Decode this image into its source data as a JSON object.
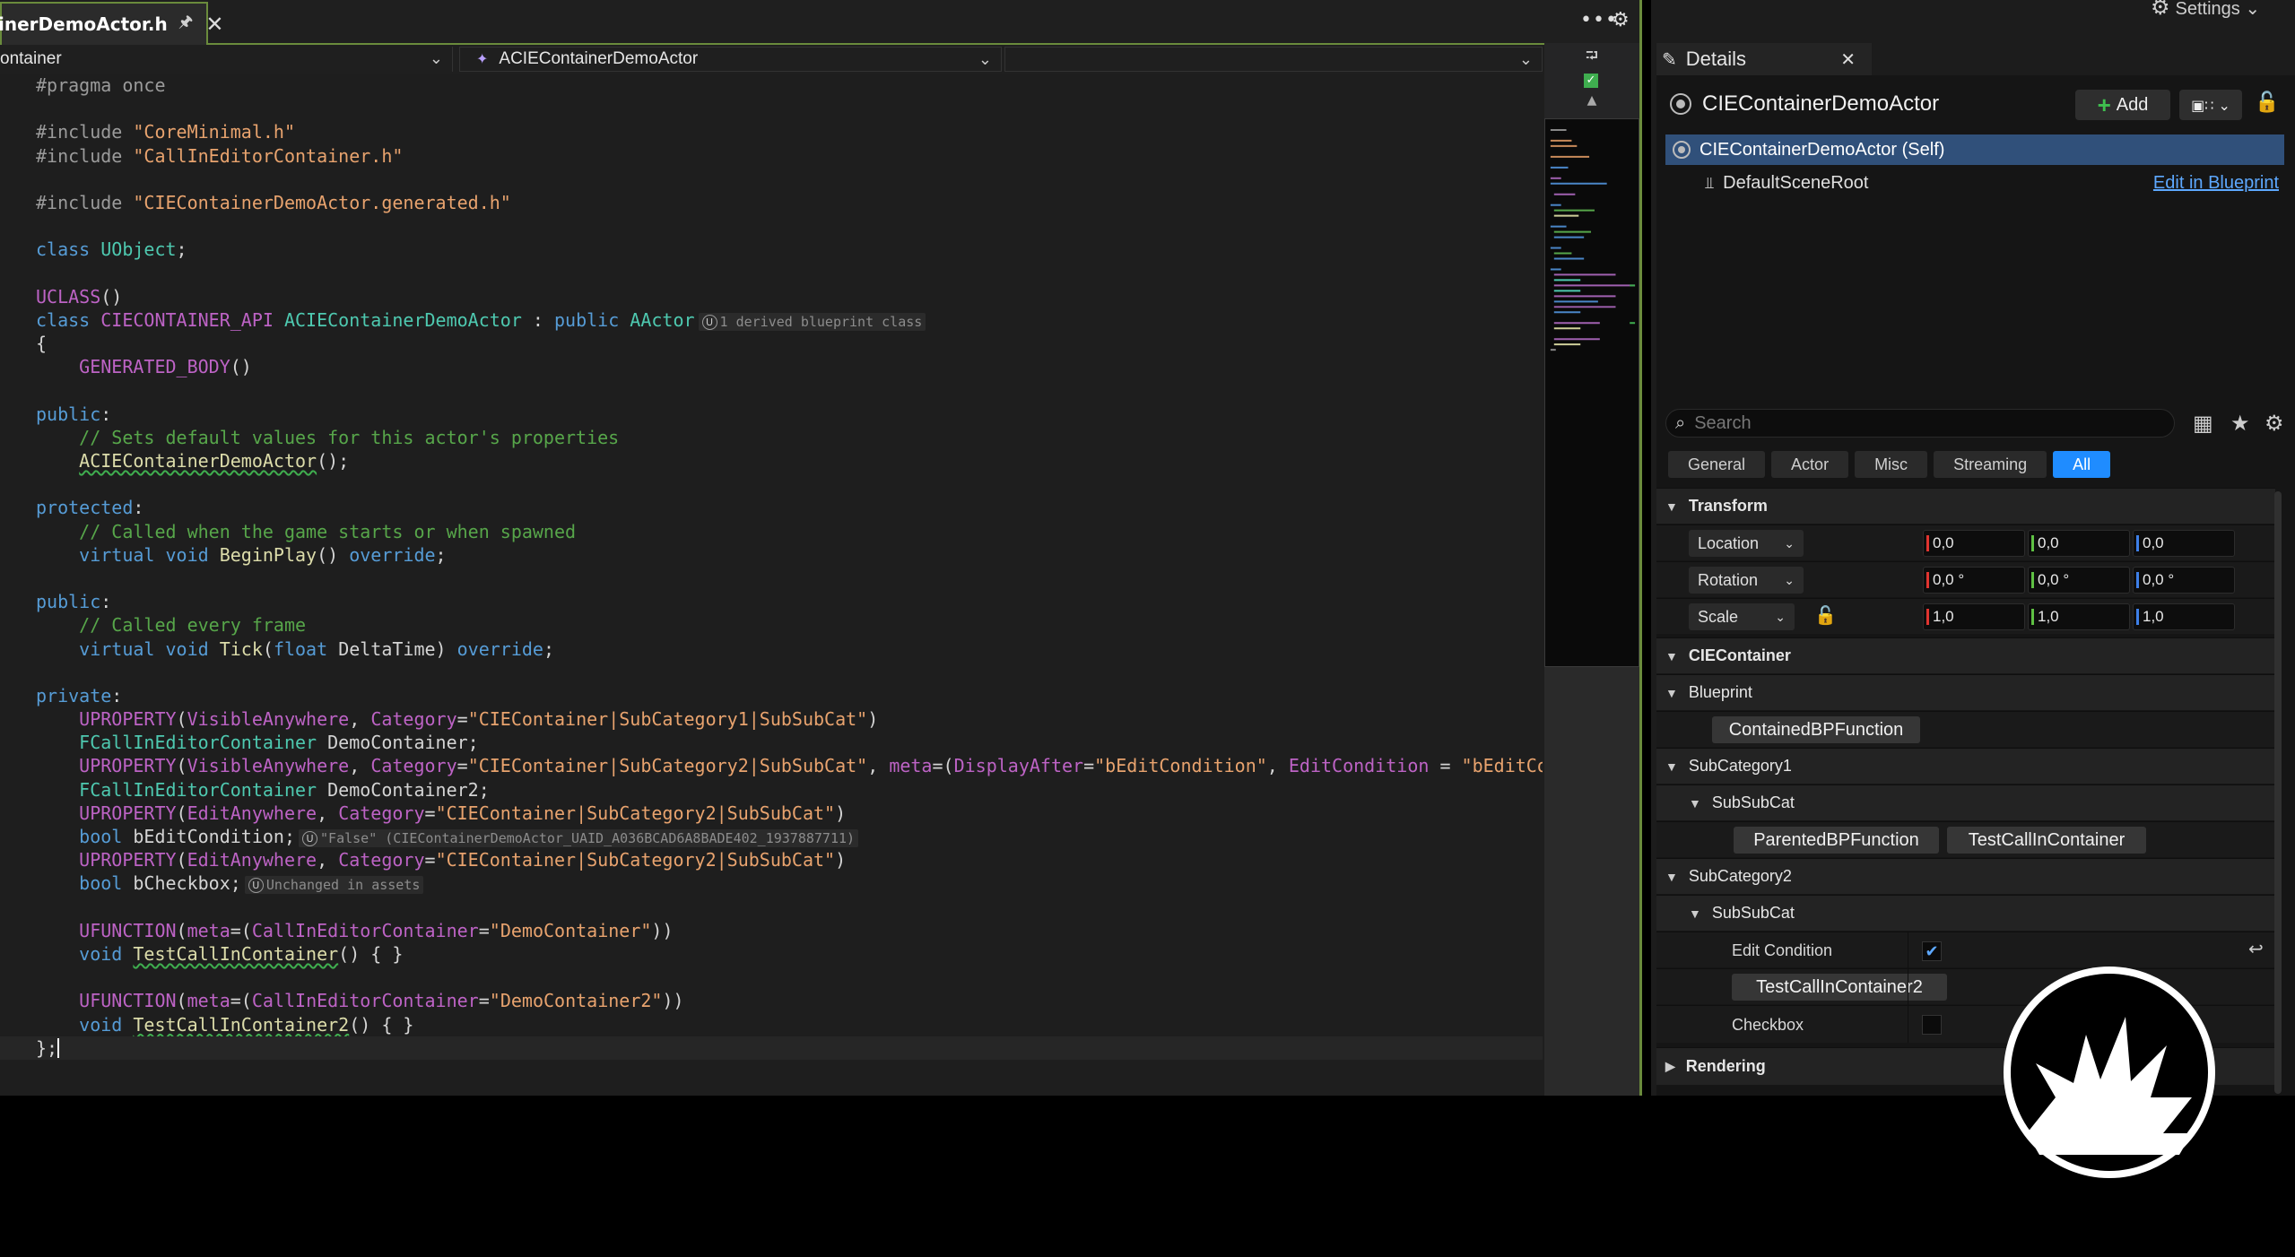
{
  "editor": {
    "tab": {
      "filename": "inerDemoActor.h",
      "pin_icon": "pin-icon",
      "close_icon": "close-icon"
    },
    "tab_actions": {
      "overflow": "•••",
      "settings_icon": "gear-icon"
    },
    "nav": {
      "scope": "ontainer",
      "class_selector": "ACIEContainerDemoActor",
      "member_selector": ""
    },
    "colors": {
      "accent_border": "#6a8b3c",
      "background": "#1e1e1e"
    }
  },
  "details": {
    "settings_label": "Settings",
    "tab_label": "Details",
    "actor_name": "CIEContainerDemoActor",
    "add_label": "Add",
    "tree": {
      "self_label": "CIEContainerDemoActor (Self)",
      "child_label": "DefaultSceneRoot",
      "edit_link": "Edit in Blueprint"
    },
    "search_placeholder": "Search",
    "filters": [
      "General",
      "Actor",
      "Misc",
      "Streaming",
      "All"
    ],
    "active_filter": "All",
    "transform": {
      "label": "Transform",
      "location": {
        "label": "Location",
        "x": "0,0",
        "y": "0,0",
        "z": "0,0"
      },
      "rotation": {
        "label": "Rotation",
        "x": "0,0 °",
        "y": "0,0 °",
        "z": "0,0 °"
      },
      "scale": {
        "label": "Scale",
        "x": "1,0",
        "y": "1,0",
        "z": "1,0"
      }
    },
    "categories": {
      "cie": "CIEContainer",
      "blueprint": "Blueprint",
      "sub1": "SubCategory1",
      "subsub1": "SubSubCat",
      "sub2": "SubCategory2",
      "subsub2": "SubSubCat",
      "rendering": "Rendering"
    },
    "buttons": {
      "contained": "ContainedBPFunction",
      "parented": "ParentedBPFunction",
      "test1": "TestCallInContainer",
      "test2": "TestCallInContainer2"
    },
    "props": {
      "edit_condition": "Edit Condition",
      "edit_condition_checked": true,
      "checkbox": "Checkbox",
      "checkbox_checked": false
    },
    "colors": {
      "selection": "#30507a",
      "active_filter": "#1f8cff",
      "link": "#5da8ff"
    }
  },
  "code_lines": [
    [
      [
        "#pragma once",
        "pp"
      ]
    ],
    [],
    [
      [
        "#include ",
        "pp"
      ],
      [
        "\"CoreMinimal.h\"",
        "str"
      ]
    ],
    [
      [
        "#include ",
        "pp"
      ],
      [
        "\"CallInEditorContainer.h\"",
        "str"
      ]
    ],
    [],
    [
      [
        "#include ",
        "pp"
      ],
      [
        "\"CIEContainerDemoActor.generated.h\"",
        "str"
      ]
    ],
    [],
    [
      [
        "class ",
        "kw"
      ],
      [
        "UObject",
        "type"
      ],
      [
        ";",
        "plain"
      ]
    ],
    [],
    [
      [
        "UCLASS",
        "macro"
      ],
      [
        "()",
        "plain"
      ]
    ],
    [
      [
        "class ",
        "kw"
      ],
      [
        "CIECONTAINER_API ",
        "macro"
      ],
      [
        "ACIEContainerDemoActor",
        "type"
      ],
      [
        " : ",
        "plain"
      ],
      [
        "public ",
        "kw"
      ],
      [
        "AActor",
        "type"
      ],
      [
        "1 derived blueprint class",
        "hint"
      ]
    ],
    [
      [
        "{",
        "plain"
      ]
    ],
    [
      [
        "    ",
        "plain"
      ],
      [
        "GENERATED_BODY",
        "macro"
      ],
      [
        "()",
        "plain"
      ]
    ],
    [],
    [
      [
        "public",
        "kw"
      ],
      [
        ":",
        "plain"
      ]
    ],
    [
      [
        "    ",
        "plain"
      ],
      [
        "// Sets default values for this actor's properties",
        "cmt"
      ]
    ],
    [
      [
        "    ",
        "plain"
      ],
      [
        "ACIEContainerDemoActor",
        "fnu"
      ],
      [
        "();",
        "plain"
      ]
    ],
    [],
    [
      [
        "protected",
        "kw"
      ],
      [
        ":",
        "plain"
      ]
    ],
    [
      [
        "    ",
        "plain"
      ],
      [
        "// Called when the game starts or when spawned",
        "cmt"
      ]
    ],
    [
      [
        "    ",
        "plain"
      ],
      [
        "virtual ",
        "kw"
      ],
      [
        "void ",
        "kw"
      ],
      [
        "BeginPlay",
        "fn"
      ],
      [
        "() ",
        "plain"
      ],
      [
        "override",
        "kw"
      ],
      [
        ";",
        "plain"
      ]
    ],
    [],
    [
      [
        "public",
        "kw"
      ],
      [
        ":",
        "plain"
      ]
    ],
    [
      [
        "    ",
        "plain"
      ],
      [
        "// Called every frame",
        "cmt"
      ]
    ],
    [
      [
        "    ",
        "plain"
      ],
      [
        "virtual ",
        "kw"
      ],
      [
        "void ",
        "kw"
      ],
      [
        "Tick",
        "fn"
      ],
      [
        "(",
        "plain"
      ],
      [
        "float ",
        "kw"
      ],
      [
        "DeltaTime) ",
        "plain"
      ],
      [
        "override",
        "kw"
      ],
      [
        ";",
        "plain"
      ]
    ],
    [],
    [
      [
        "private",
        "kw"
      ],
      [
        ":",
        "plain"
      ]
    ],
    [
      [
        "    ",
        "plain"
      ],
      [
        "UPROPERTY",
        "macro"
      ],
      [
        "(",
        "plain"
      ],
      [
        "VisibleAnywhere",
        "macro"
      ],
      [
        ", ",
        "plain"
      ],
      [
        "Category",
        "macro"
      ],
      [
        "=",
        "plain"
      ],
      [
        "\"CIEContainer|SubCategory1|SubSubCat\"",
        "str"
      ],
      [
        ")",
        "plain"
      ]
    ],
    [
      [
        "    ",
        "plain"
      ],
      [
        "FCallInEditorContainer ",
        "type"
      ],
      [
        "DemoContainer;",
        "plain"
      ]
    ],
    [
      [
        "    ",
        "plain"
      ],
      [
        "UPROPERTY",
        "macro"
      ],
      [
        "(",
        "plain"
      ],
      [
        "VisibleAnywhere",
        "macro"
      ],
      [
        ", ",
        "plain"
      ],
      [
        "Category",
        "macro"
      ],
      [
        "=",
        "plain"
      ],
      [
        "\"CIEContainer|SubCategory2|SubSubCat\"",
        "str"
      ],
      [
        ", ",
        "plain"
      ],
      [
        "meta",
        "macro"
      ],
      [
        "=(",
        "plain"
      ],
      [
        "DisplayAfter",
        "macro"
      ],
      [
        "=",
        "plain"
      ],
      [
        "\"bEditCondition\"",
        "str"
      ],
      [
        ", ",
        "plain"
      ],
      [
        "EditCondition",
        "macro"
      ],
      [
        " = ",
        "plain"
      ],
      [
        "\"bEditCondi",
        "str"
      ]
    ],
    [
      [
        "    ",
        "plain"
      ],
      [
        "FCallInEditorContainer ",
        "type"
      ],
      [
        "DemoContainer2;",
        "plain"
      ]
    ],
    [
      [
        "    ",
        "plain"
      ],
      [
        "UPROPERTY",
        "macro"
      ],
      [
        "(",
        "plain"
      ],
      [
        "EditAnywhere",
        "macro"
      ],
      [
        ", ",
        "plain"
      ],
      [
        "Category",
        "macro"
      ],
      [
        "=",
        "plain"
      ],
      [
        "\"CIEContainer|SubCategory2|SubSubCat\"",
        "str"
      ],
      [
        ")",
        "plain"
      ]
    ],
    [
      [
        "    ",
        "plain"
      ],
      [
        "bool ",
        "kw"
      ],
      [
        "bEditCondition;",
        "plain"
      ],
      [
        "\"False\" (CIEContainerDemoActor_UAID_A036BCAD6A8BADE402_1937887711)",
        "hint"
      ]
    ],
    [
      [
        "    ",
        "plain"
      ],
      [
        "UPROPERTY",
        "macro"
      ],
      [
        "(",
        "plain"
      ],
      [
        "EditAnywhere",
        "macro"
      ],
      [
        ", ",
        "plain"
      ],
      [
        "Category",
        "macro"
      ],
      [
        "=",
        "plain"
      ],
      [
        "\"CIEContainer|SubCategory2|SubSubCat\"",
        "str"
      ],
      [
        ")",
        "plain"
      ]
    ],
    [
      [
        "    ",
        "plain"
      ],
      [
        "bool ",
        "kw"
      ],
      [
        "bCheckbox;",
        "plain"
      ],
      [
        "Unchanged in assets",
        "hint"
      ]
    ],
    [],
    [
      [
        "    ",
        "plain"
      ],
      [
        "UFUNCTION",
        "macro"
      ],
      [
        "(",
        "plain"
      ],
      [
        "meta",
        "macro"
      ],
      [
        "=(",
        "plain"
      ],
      [
        "CallInEditorContainer",
        "macro"
      ],
      [
        "=",
        "plain"
      ],
      [
        "\"DemoContainer\"",
        "str"
      ],
      [
        "))",
        "plain"
      ]
    ],
    [
      [
        "    ",
        "plain"
      ],
      [
        "void ",
        "kw"
      ],
      [
        "TestCallInContainer",
        "fnu"
      ],
      [
        "() { }",
        "plain"
      ]
    ],
    [],
    [
      [
        "    ",
        "plain"
      ],
      [
        "UFUNCTION",
        "macro"
      ],
      [
        "(",
        "plain"
      ],
      [
        "meta",
        "macro"
      ],
      [
        "=(",
        "plain"
      ],
      [
        "CallInEditorContainer",
        "macro"
      ],
      [
        "=",
        "plain"
      ],
      [
        "\"DemoContainer2\"",
        "str"
      ],
      [
        "))",
        "plain"
      ]
    ],
    [
      [
        "    ",
        "plain"
      ],
      [
        "void ",
        "kw"
      ],
      [
        "TestCallInContainer2",
        "fnu"
      ],
      [
        "() { }",
        "plain"
      ]
    ],
    [
      [
        "};",
        "plain"
      ],
      [
        "",
        "cursor"
      ]
    ]
  ]
}
